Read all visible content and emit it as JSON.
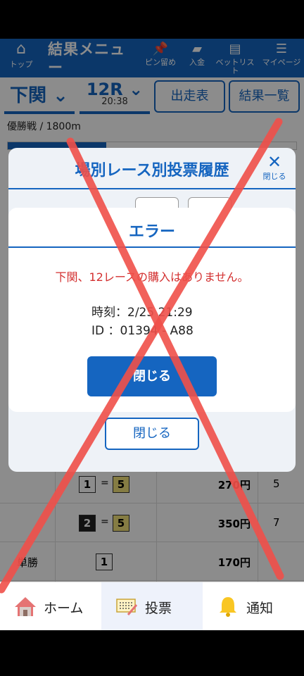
{
  "header": {
    "home_label": "トップ",
    "title": "結果メニュー",
    "nav": [
      {
        "label": "ピン留め"
      },
      {
        "label": "入金"
      },
      {
        "label": "ベットリスト"
      },
      {
        "label": "マイページ"
      }
    ]
  },
  "race": {
    "venue": "下関",
    "number": "12R",
    "time": "20:38",
    "btn_entries": "出走表",
    "btn_results": "結果一覧",
    "subtitle": "優勝戦 / 1800m"
  },
  "results": [
    {
      "first": "1",
      "second": "5",
      "amount": "270円",
      "pop": "5"
    },
    {
      "first": "2",
      "second": "5",
      "amount": "350円",
      "pop": "7"
    },
    {
      "label": "単勝",
      "first": "1",
      "amount": "170円"
    }
  ],
  "history_modal": {
    "title": "場別レース別投票履歴",
    "close_label": "閉じる",
    "close_button": "閉じる"
  },
  "error_dialog": {
    "title": "エラー",
    "message": "下関、12レースの購入はありません。",
    "time_line": "時刻：2/25 21:29",
    "id_line": "ID ：01394 - A88",
    "close_button": "閉じる"
  },
  "bottom_nav": {
    "home": "ホーム",
    "vote": "投票",
    "notify": "通知"
  },
  "colors": {
    "brand_blue": "#1565c0",
    "error_red": "#d32f2f",
    "annotation_red": "#f0504a"
  }
}
